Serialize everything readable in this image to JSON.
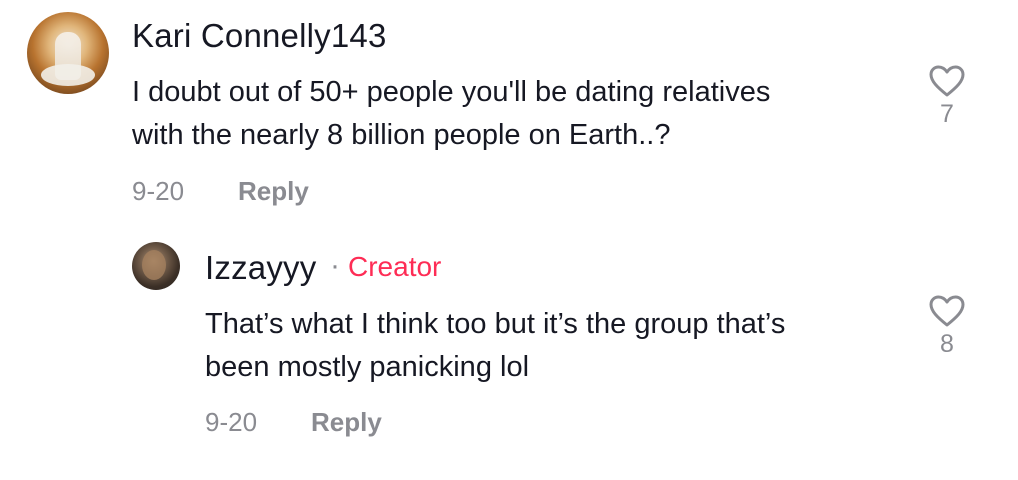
{
  "comment": {
    "username": "Kari Connelly143",
    "text_lines": [
      "I doubt out of 50+ people you'll be dating relatives",
      "with the nearly 8 billion people on Earth..?"
    ],
    "date": "9-20",
    "reply_label": "Reply",
    "like_count": "7"
  },
  "reply": {
    "username": "Izzayyy",
    "separator": "·",
    "badge": "Creator",
    "text_lines": [
      "That’s what I think too but it’s the group that’s",
      "been mostly panicking lol"
    ],
    "date": "9-20",
    "reply_label": "Reply",
    "like_count": "8"
  },
  "colors": {
    "text_primary": "#161823",
    "text_secondary": "#8a8b91",
    "creator_badge": "#fe2c55",
    "background": "#ffffff"
  }
}
